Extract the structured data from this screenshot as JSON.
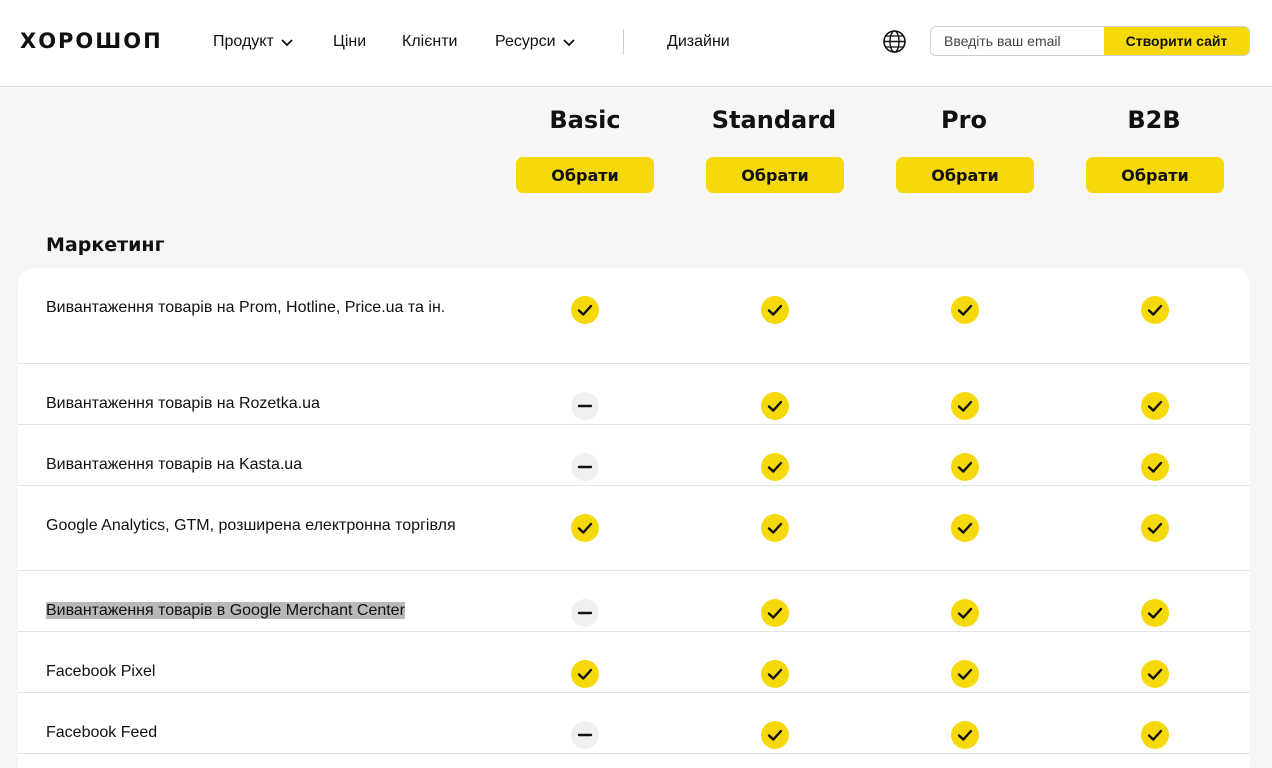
{
  "header": {
    "logo": "ХОРОШОП",
    "nav": [
      {
        "label": "Продукт",
        "dropdown": true
      },
      {
        "label": "Ціни",
        "dropdown": false
      },
      {
        "label": "Клієнти",
        "dropdown": false
      },
      {
        "label": "Ресурси",
        "dropdown": true
      },
      {
        "label": "Дизайни",
        "dropdown": false
      }
    ],
    "email_placeholder": "Введіть ваш email",
    "create_button": "Створити сайт",
    "globe_icon": "globe-icon"
  },
  "plans": [
    {
      "name": "Basic",
      "button": "Обрати"
    },
    {
      "name": "Standard",
      "button": "Обрати"
    },
    {
      "name": "Pro",
      "button": "Обрати"
    },
    {
      "name": "B2B",
      "button": "Обрати"
    }
  ],
  "section": {
    "title": "Маркетинг",
    "rows": [
      {
        "feature": "Вивантаження товарів на Prom, Hotline, Price.ua та ін.",
        "marks": [
          "yes",
          "yes",
          "yes",
          "yes"
        ]
      },
      {
        "feature": "Вивантаження товарів на Rozetka.ua",
        "marks": [
          "no",
          "yes",
          "yes",
          "yes"
        ]
      },
      {
        "feature": "Вивантаження товарів на Kasta.ua",
        "marks": [
          "no",
          "yes",
          "yes",
          "yes"
        ]
      },
      {
        "feature": "Google Analytics, GTM, розширена електронна торгівля",
        "marks": [
          "yes",
          "yes",
          "yes",
          "yes"
        ]
      },
      {
        "feature": "Вивантаження товарів в Google Merchant Center",
        "marks": [
          "no",
          "yes",
          "yes",
          "yes"
        ],
        "highlighted": true
      },
      {
        "feature": "Facebook Pixel",
        "marks": [
          "yes",
          "yes",
          "yes",
          "yes"
        ]
      },
      {
        "feature": "Facebook Feed",
        "marks": [
          "no",
          "yes",
          "yes",
          "yes"
        ]
      }
    ]
  },
  "colors": {
    "accent": "#f5d90a",
    "background": "#f7f6f4",
    "card": "#ffffff",
    "neutral_mark": "#f0f0f0"
  }
}
